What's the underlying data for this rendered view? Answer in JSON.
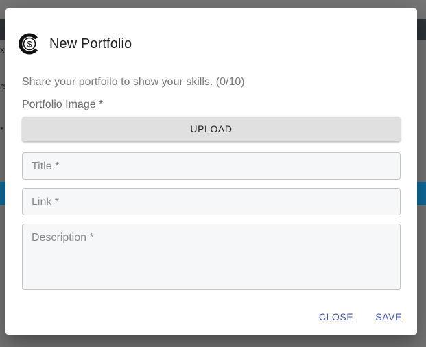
{
  "background": {
    "fragments": [
      "x",
      "rs",
      "•"
    ],
    "overlay_color": "#767676",
    "topbar_color": "#2e3338",
    "bluebar_color": "#0f6e9e"
  },
  "dialog": {
    "logo_icon": "currency-c-dollar-icon",
    "title": "New Portfolio",
    "subtitle": "Share your portfoilo to show your skills. (0/10)",
    "image_label": "Portfolio Image *",
    "upload_label": "UPLOAD",
    "fields": {
      "title_placeholder": "Title *",
      "link_placeholder": "Link *",
      "description_placeholder": "Description *"
    },
    "actions": {
      "close_label": "CLOSE",
      "save_label": "SAVE"
    },
    "accent_color": "#3f51b5"
  }
}
